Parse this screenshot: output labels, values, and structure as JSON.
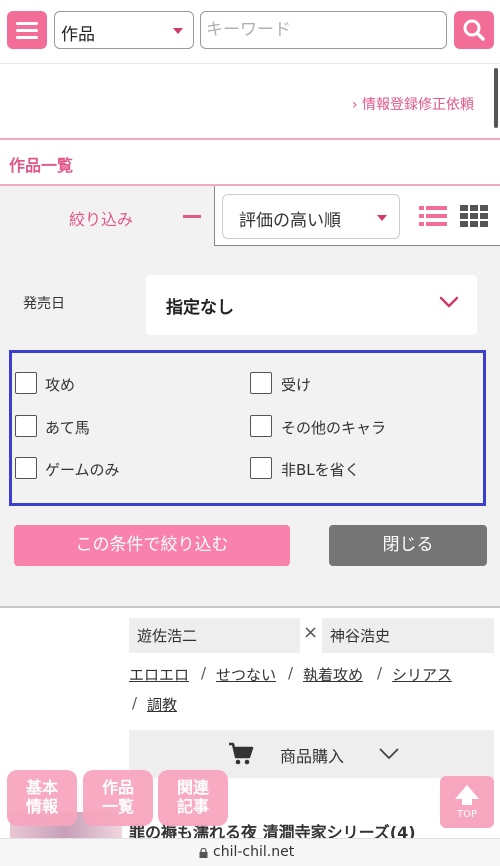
{
  "header": {
    "menu_icon": "hamburger-menu-icon",
    "category_value": "作品",
    "keyword_placeholder": "キーワード",
    "search_icon": "search-icon",
    "accent_color": "#f26d98"
  },
  "request_link": "› 情報登録修正依頼",
  "section_title": "作品一覧",
  "filter": {
    "tab_label": "絞り込み",
    "sort_value": "評価の高い順",
    "view_list_icon": "list-view-icon",
    "view_grid_icon": "grid-view-icon",
    "release_date_label": "発売日",
    "release_date_value": "指定なし",
    "checkboxes": [
      {
        "label": "攻め"
      },
      {
        "label": "受け"
      },
      {
        "label": "あて馬"
      },
      {
        "label": "その他のキャラ"
      },
      {
        "label": "ゲームのみ"
      },
      {
        "label": "非BLを省く"
      }
    ],
    "apply_label": "この条件で絞り込む",
    "close_label": "閉じる"
  },
  "result": {
    "cast": [
      "遊佐浩二",
      "神谷浩史"
    ],
    "times": "×",
    "tags": [
      "エロエロ",
      "せつない",
      "執着攻め",
      "シリアス",
      "調教"
    ],
    "slash": "/",
    "buy_label": "商品購入",
    "title": "罪の褥も濡れる夜 清澗寺家シリーズ(4)"
  },
  "float_nav": {
    "basic_info": [
      "基本",
      "情報"
    ],
    "works_list": [
      "作品",
      "一覧"
    ],
    "related": [
      "関連",
      "記事"
    ],
    "top_label": "TOP"
  },
  "url_bar": {
    "domain": "chil-chil.net"
  }
}
